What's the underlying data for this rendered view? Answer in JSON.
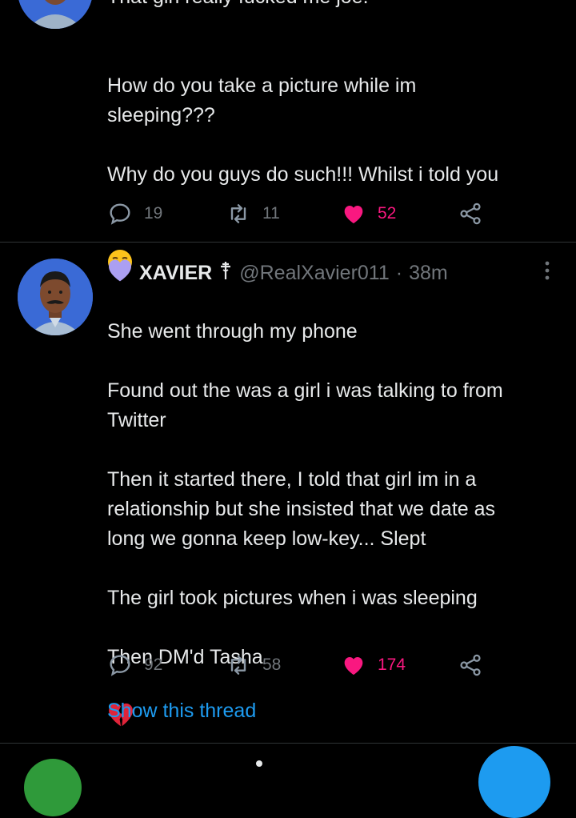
{
  "tweet1": {
    "text_top_clipped": "That girl really fucked me joe.",
    "text": "How do you take a picture while im\nsleeping???\n\nWhy do you guys do such!!! Whilst i told you",
    "emoji_name": "unamused-face",
    "reply_count": "19",
    "retweet_count": "11",
    "like_count": "52"
  },
  "tweet2": {
    "badge_icon": "purple-heart",
    "display_name": "XAVIER",
    "name_icon": "cross-icon",
    "handle": "@RealXavier011",
    "separator": "·",
    "time": "38m",
    "text": "She went through my phone\n\nFound out the was a girl i was talking to from\nTwitter\n\nThen it started there, I told that girl im in a\nrelationship but she insisted that we date as\nlong we gonna keep low-key... Slept\n\nThe girl took pictures when i was sleeping\n\nThen DM'd Tasha",
    "emoji_name": "broken-heart",
    "reply_count": "92",
    "retweet_count": "58",
    "like_count": "174",
    "show_thread": "Show this thread"
  },
  "colors": {
    "background": "#000000",
    "text": "#e7e9ea",
    "muted": "#71767b",
    "like": "#f91880",
    "link": "#1d9bf0",
    "divider": "#2f3336",
    "purple_heart": "#ab9ff2"
  }
}
